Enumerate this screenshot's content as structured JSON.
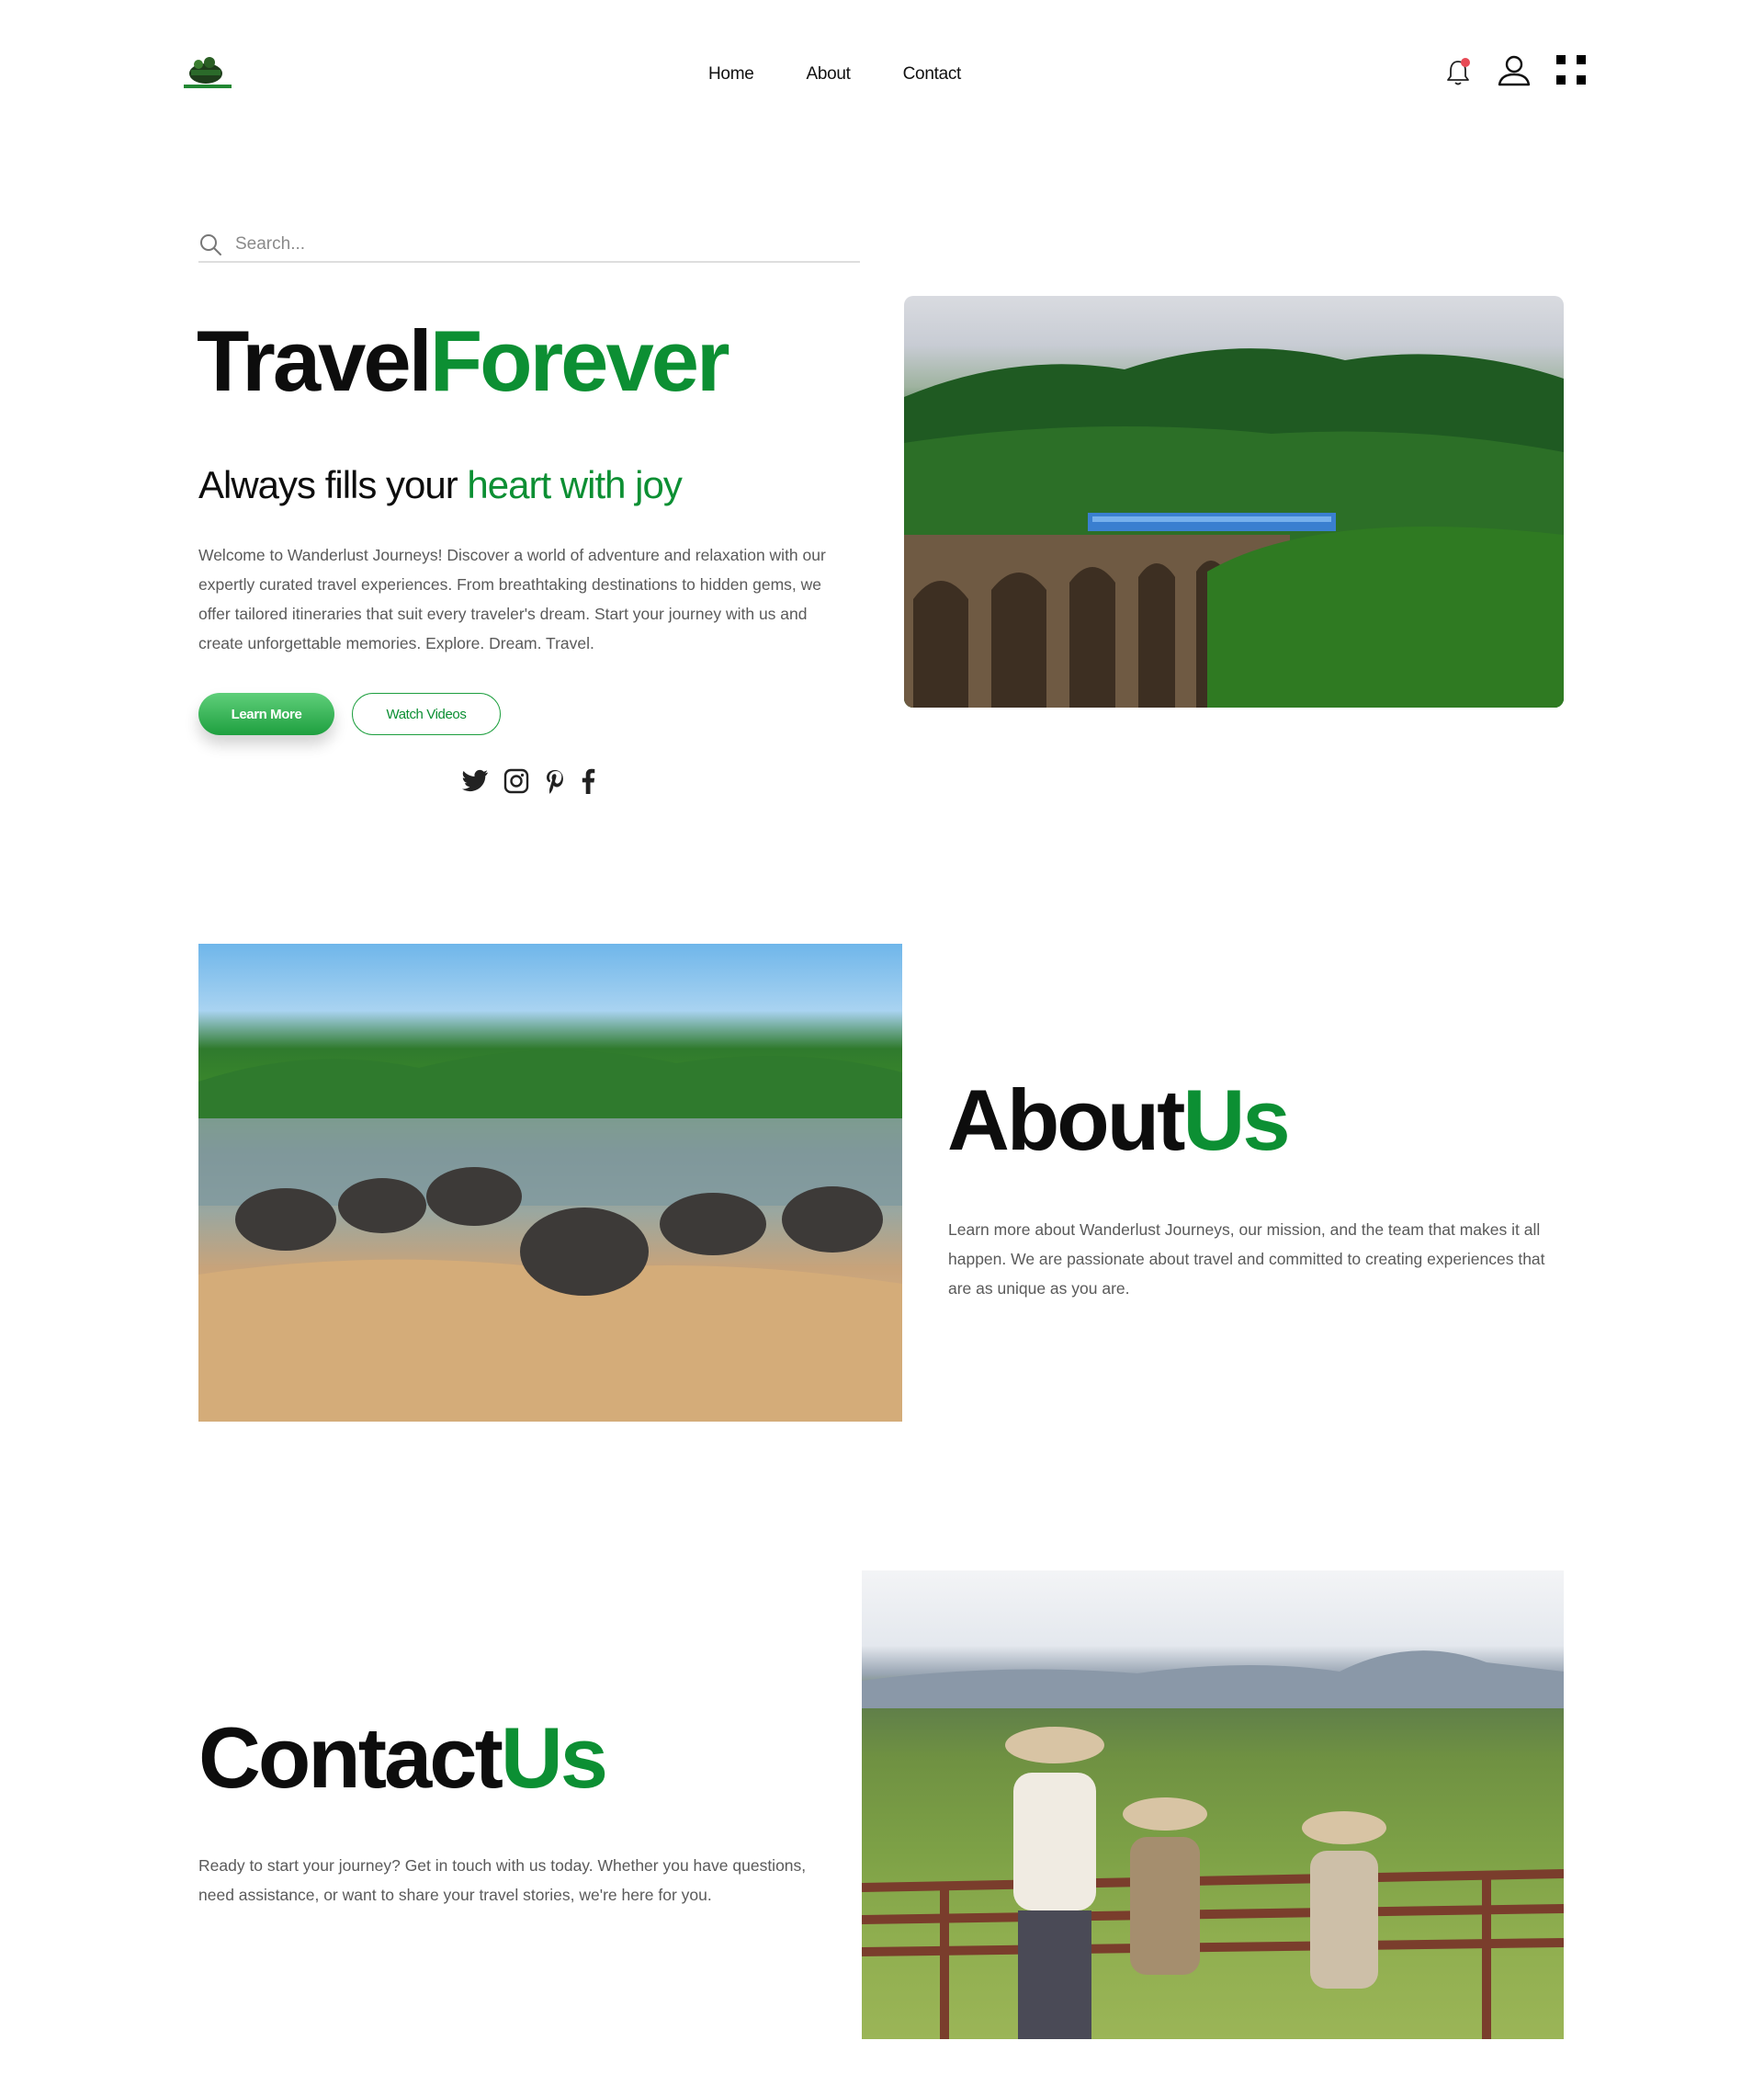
{
  "header": {
    "logo_alt": "Travel Forever",
    "nav": [
      {
        "label": "Home"
      },
      {
        "label": "About"
      },
      {
        "label": "Contact"
      }
    ],
    "notification_count": 1,
    "icons": [
      "bell-icon",
      "user-icon",
      "grid-menu-icon"
    ]
  },
  "hero": {
    "search_placeholder": "Search...",
    "title_part1": "Travel",
    "title_part2": "Forever",
    "subtitle_part1": "Always fills your ",
    "subtitle_part2": "heart with joy",
    "text": "Welcome to Wanderlust Journeys! Discover a world of adventure and relaxation with our expertly curated travel experiences. From breathtaking destinations to hidden gems, we offer tailored itineraries that suit every traveler's dream. Start your journey with us and create unforgettable memories. Explore. Dream. Travel.",
    "btn_learn": "Learn More",
    "btn_watch": "Watch Videos",
    "socials": [
      "twitter-icon",
      "instagram-icon",
      "pinterest-icon",
      "facebook-icon"
    ]
  },
  "about": {
    "title_part1": "About",
    "title_part2": "Us",
    "text": "Learn more about Wanderlust Journeys, our mission, and the team that makes it all happen. We are passionate about travel and committed to creating experiences that are as unique as you are."
  },
  "contact": {
    "title_part1": "Contact",
    "title_part2": "Us",
    "text": "Ready to start your journey? Get in touch with us today. Whether you have questions, need assistance, or want to share your travel stories, we're here for you."
  },
  "colors": {
    "accent_green": "#0c8f33",
    "button_gradient_top": "#5fcf7a",
    "button_gradient_bottom": "#1e9f3f"
  }
}
